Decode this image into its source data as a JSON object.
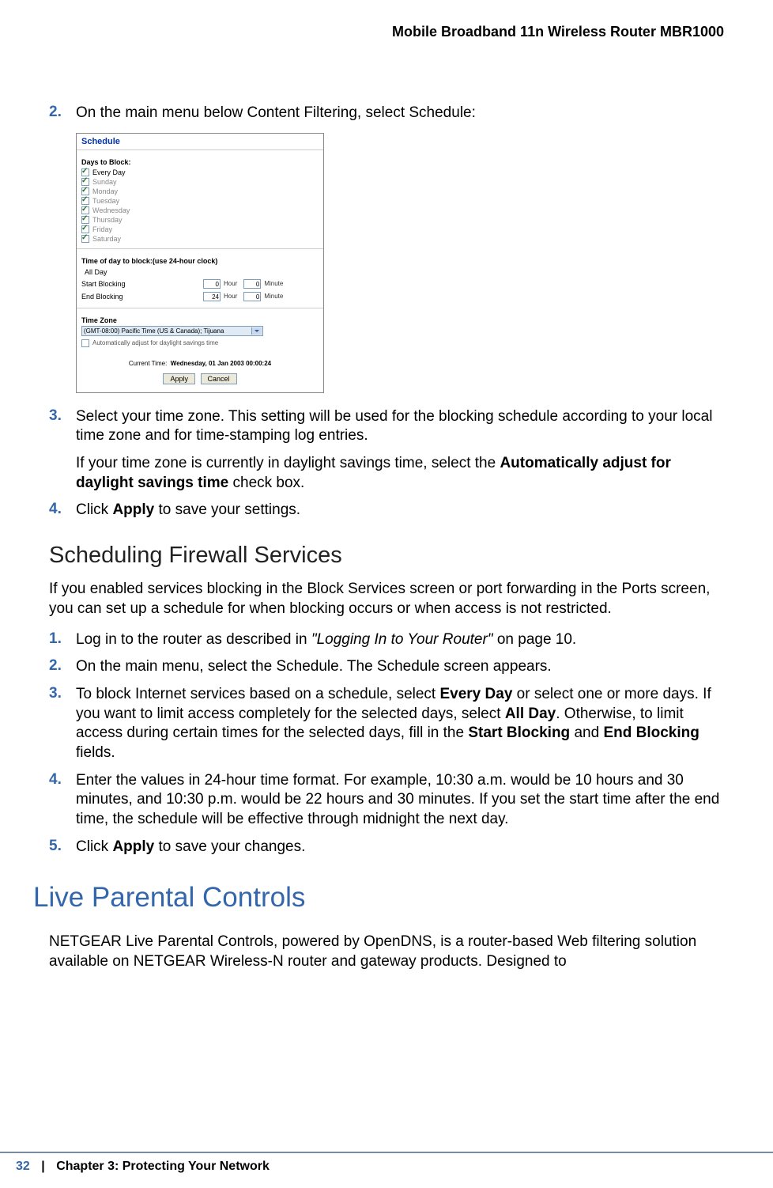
{
  "header": {
    "title": "Mobile Broadband 11n Wireless Router MBR1000"
  },
  "steps_a": [
    {
      "num": "2.",
      "text": "On the main menu below Content Filtering, select Schedule:"
    }
  ],
  "ui": {
    "title": "Schedule",
    "days_label": "Days to Block:",
    "days": [
      {
        "label": "Every Day",
        "checked": true,
        "dim": false
      },
      {
        "label": "Sunday",
        "checked": true,
        "dim": true
      },
      {
        "label": "Monday",
        "checked": true,
        "dim": true
      },
      {
        "label": "Tuesday",
        "checked": true,
        "dim": true
      },
      {
        "label": "Wednesday",
        "checked": true,
        "dim": true
      },
      {
        "label": "Thursday",
        "checked": true,
        "dim": true
      },
      {
        "label": "Friday",
        "checked": true,
        "dim": true
      },
      {
        "label": "Saturday",
        "checked": true,
        "dim": true
      }
    ],
    "time_label": "Time of day to block:(use 24-hour clock)",
    "all_day": {
      "label": "All Day",
      "checked": true
    },
    "start": {
      "label": "Start Blocking",
      "hour": "0",
      "hour_unit": "Hour",
      "min": "0",
      "min_unit": "Minute"
    },
    "end": {
      "label": "End Blocking",
      "hour": "24",
      "hour_unit": "Hour",
      "min": "0",
      "min_unit": "Minute"
    },
    "tz_label": "Time Zone",
    "tz_value": "(GMT-08:00) Pacific Time (US & Canada); Tijuana",
    "dst_label": "Automatically adjust for daylight savings time",
    "current_time_label": "Current Time:",
    "current_time_value": "Wednesday, 01 Jan 2003 00:00:24",
    "apply": "Apply",
    "cancel": "Cancel"
  },
  "steps_b": [
    {
      "num": "3.",
      "text": "Select your time zone. This setting will be used for the blocking schedule according to your local time zone and for time-stamping log entries.",
      "extra_pre": "If your time zone is currently in daylight savings time, select the ",
      "extra_bold": "Automatically adjust for daylight savings time",
      "extra_post": " check box."
    },
    {
      "num": "4.",
      "pre": "Click ",
      "bold": "Apply",
      "post": " to save your settings."
    }
  ],
  "h2": "Scheduling Firewall Services",
  "para1": "If you enabled services blocking in the Block Services screen or port forwarding in the Ports screen, you can set up a schedule for when blocking occurs or when access is not restricted.",
  "steps_c": {
    "s1": {
      "num": "1.",
      "pre": "Log in to the router as described in ",
      "ital": "\"Logging In to Your Router\"",
      "post": " on page 10."
    },
    "s2": {
      "num": "2.",
      "text": "On the main menu, select the Schedule. The Schedule screen appears."
    },
    "s3": {
      "num": "3.",
      "p1": "To block Internet services based on a schedule, select ",
      "b1": "Every Day",
      "p2": " or select one or more days. If you want to limit access completely for the selected days, select ",
      "b2": "All Day",
      "p3": ". Otherwise, to limit access during certain times for the selected days, fill in the ",
      "b3": "Start Blocking",
      "p4": " and ",
      "b4": "End Blocking",
      "p5": " fields."
    },
    "s4": {
      "num": "4.",
      "text": "Enter the values in 24-hour time format. For example, 10:30 a.m. would be 10 hours and 30 minutes, and 10:30 p.m. would be 22 hours and 30 minutes. If you set the start time after the end time, the schedule will be effective through midnight the next day."
    },
    "s5": {
      "num": "5.",
      "pre": "Click ",
      "bold": "Apply",
      "post": " to save your changes."
    }
  },
  "h1": "Live Parental Controls",
  "para2": "NETGEAR Live Parental Controls, powered by OpenDNS, is a router-based Web filtering solution available on NETGEAR Wireless-N router and gateway products. Designed to",
  "footer": {
    "page": "32",
    "sep": "|",
    "chapter": "Chapter 3:  Protecting Your Network"
  }
}
